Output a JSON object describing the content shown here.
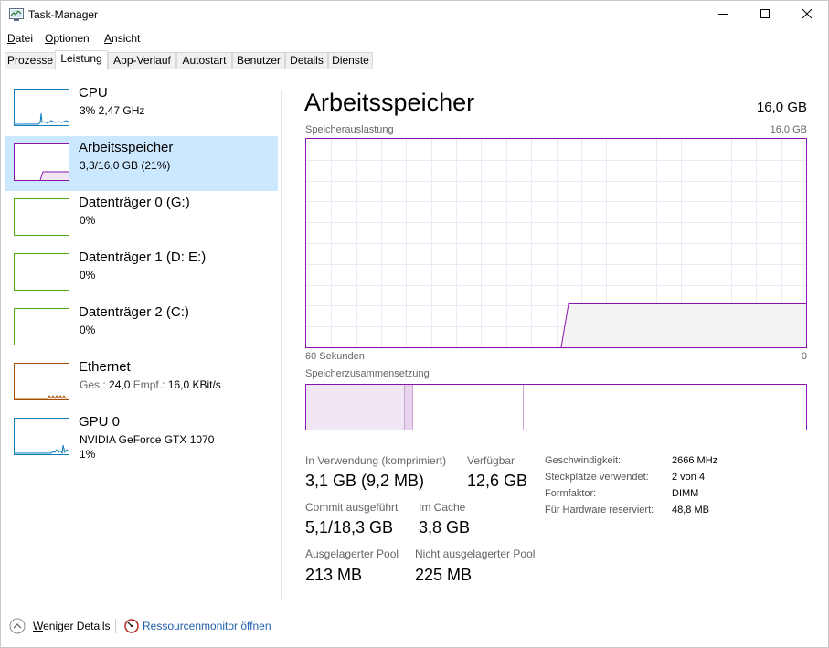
{
  "window": {
    "title": "Task-Manager",
    "minimize_icon": "minimize-icon",
    "maximize_icon": "maximize-icon",
    "close_icon": "close-icon"
  },
  "menu": [
    {
      "label": "Datei",
      "key": "D",
      "rest": "atei"
    },
    {
      "label": "Optionen",
      "key": "O",
      "rest": "ptionen"
    },
    {
      "label": "Ansicht",
      "key": "A",
      "rest": "nsicht"
    }
  ],
  "tabs": [
    {
      "label": "Prozesse",
      "active": false
    },
    {
      "label": "Leistung",
      "active": true
    },
    {
      "label": "App-Verlauf",
      "active": false
    },
    {
      "label": "Autostart",
      "active": false
    },
    {
      "label": "Benutzer",
      "active": false
    },
    {
      "label": "Details",
      "active": false
    },
    {
      "label": "Dienste",
      "active": false
    }
  ],
  "sidebar": [
    {
      "name": "CPU",
      "sub1": "3%  2,47 GHz",
      "sub2": "",
      "sub3": "",
      "color": "#117dbb",
      "selected": false
    },
    {
      "name": "Arbeitsspeicher",
      "sub1": "3,3/16,0 GB (21%)",
      "sub2": "",
      "sub3": "",
      "color": "#8b12ae",
      "selected": true
    },
    {
      "name": "Datenträger 0 (G:)",
      "sub1": "0%",
      "sub2": "",
      "sub3": "",
      "color": "#4da60c",
      "selected": false
    },
    {
      "name": "Datenträger 1 (D: E:)",
      "sub1": "0%",
      "sub2": "",
      "sub3": "",
      "color": "#4da60c",
      "selected": false
    },
    {
      "name": "Datenträger 2 (C:)",
      "sub1": "0%",
      "sub2": "",
      "sub3": "",
      "color": "#4da60c",
      "selected": false
    },
    {
      "name": "Ethernet",
      "sub1": "Ges.: 24,0  Empf.: 16,0 KBit/s",
      "sub2": "",
      "sub3": "",
      "color": "#a74f01",
      "selected": false
    },
    {
      "name": "GPU 0",
      "sub1": "NVIDIA GeForce GTX 1070",
      "sub2": "1%",
      "sub3": "",
      "color": "#117dbb",
      "selected": false
    }
  ],
  "ethernet_sub": {
    "ges_label": "Ges.:",
    "ges_value": "24,0",
    "empf_label": "Empf.:",
    "empf_value": "16,0 KBit/s"
  },
  "main": {
    "title": "Arbeitsspeicher",
    "total": "16,0 GB",
    "graph_label": "Speicherauslastung",
    "graph_max": "16,0 GB",
    "graph_time_left": "60 Sekunden",
    "graph_time_right": "0",
    "composition_label": "Speicherzusammensetzung",
    "usage_fraction": 0.21,
    "accent_color": "#8b12ae"
  },
  "stats": {
    "in_use_label": "In Verwendung (komprimiert)",
    "in_use_value": "3,1 GB (9,2 MB)",
    "available_label": "Verfügbar",
    "available_value": "12,6 GB",
    "commit_label": "Commit ausgeführt",
    "commit_value": "5,1/18,3 GB",
    "cache_label": "Im Cache",
    "cache_value": "3,8 GB",
    "paged_label": "Ausgelagerter Pool",
    "paged_value": "213 MB",
    "nonpaged_label": "Nicht ausgelagerter Pool",
    "nonpaged_value": "225 MB"
  },
  "details": [
    {
      "label": "Geschwindigkeit:",
      "value": "2666 MHz"
    },
    {
      "label": "Steckplätze verwendet:",
      "value": "2 von 4"
    },
    {
      "label": "Formfaktor:",
      "value": "DIMM"
    },
    {
      "label": "Für Hardware reserviert:",
      "value": "48,8 MB"
    }
  ],
  "footer": {
    "fewer_details": "Weniger Details",
    "fewer_details_key": "W",
    "fewer_details_rest": "eniger Details",
    "resource_monitor": "Ressourcenmonitor öffnen"
  }
}
